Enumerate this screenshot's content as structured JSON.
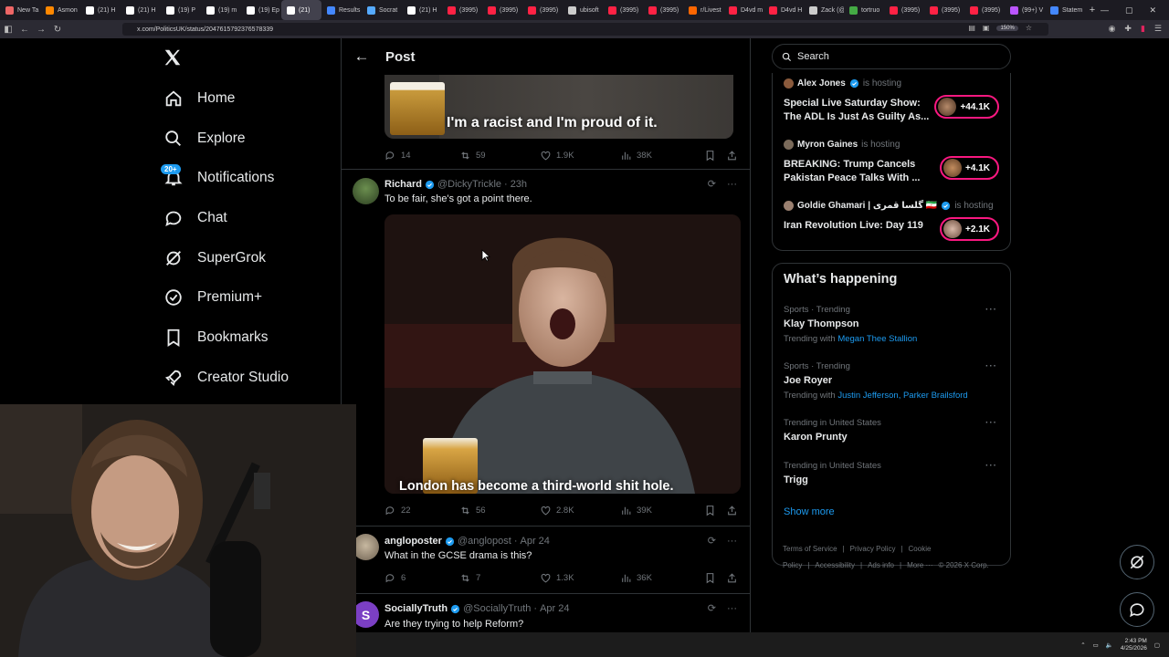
{
  "browser": {
    "tabs": [
      "New Ta",
      "Asmon",
      "(21) H",
      "(21) H",
      "(19) P",
      "(19) m",
      "(19) Ep",
      "(21)",
      "Results",
      "Socrat",
      "(21) H",
      "(3995)",
      "(3995)",
      "(3995)",
      "ubisoft",
      "(3995)",
      "(3995)",
      "r/Livest",
      "D4vd m",
      "D4vd H",
      "Zack (@",
      "tortruo",
      "(3995)",
      "(3995)",
      "(3995)",
      "(99+) V",
      "Statem"
    ],
    "url": "x.com/PoliticsUK/status/2047615792376578339",
    "zoom": "150%"
  },
  "leftnav": {
    "items": [
      {
        "label": "Home",
        "icon": "home-icon"
      },
      {
        "label": "Explore",
        "icon": "search-icon"
      },
      {
        "label": "Notifications",
        "icon": "bell-icon"
      },
      {
        "label": "Chat",
        "icon": "chat-icon"
      },
      {
        "label": "SuperGrok",
        "icon": "grok-icon"
      },
      {
        "label": "Premium+",
        "icon": "premium-icon"
      },
      {
        "label": "Bookmarks",
        "icon": "bookmark-icon"
      },
      {
        "label": "Creator Studio",
        "icon": "rocket-icon"
      }
    ],
    "notification_badge": "20+"
  },
  "header": {
    "title": "Post"
  },
  "tweets": [
    {
      "media_caption": "I'm a racist and I'm proud of it.",
      "replies": "14",
      "reposts": "59",
      "likes": "1.9K",
      "views": "38K"
    },
    {
      "name": "Richard",
      "handle": "@DickyTrickle",
      "time": "23h",
      "text": "To be fair, she's got a point there.",
      "media_caption": "London has become a third-world shit hole.",
      "replies": "22",
      "reposts": "56",
      "likes": "2.8K",
      "views": "39K"
    },
    {
      "name": "angloposter",
      "handle": "@anglopost",
      "time": "Apr 24",
      "text": "What in the GCSE drama is this?",
      "replies": "6",
      "reposts": "7",
      "likes": "1.3K",
      "views": "36K"
    },
    {
      "name": "SociallyTruth",
      "handle": "@SociallyTruth",
      "time": "Apr 24",
      "text": "Are they trying to help Reform?"
    }
  ],
  "search": {
    "placeholder": "Search"
  },
  "spaces": [
    {
      "host": "Alex Jones",
      "status": "is hosting",
      "title": "Special Live Saturday Show: The ADL Is Just As Guilty As...",
      "listeners": "+44.1K"
    },
    {
      "host": "Myron Gaines",
      "status": "is hosting",
      "title": "BREAKING: Trump Cancels Pakistan Peace Talks With ...",
      "listeners": "+4.1K"
    },
    {
      "host": "Goldie Ghamari | گلسا قمری 🇮🇷",
      "status": "is hosting",
      "title": "Iran Revolution Live: Day 119",
      "listeners": "+2.1K"
    }
  ],
  "whats_happening": {
    "title": "What’s happening",
    "trends": [
      {
        "meta": "Sports · Trending",
        "name": "Klay Thompson",
        "with_prefix": "Trending with",
        "with": "Megan Thee Stallion"
      },
      {
        "meta": "Sports · Trending",
        "name": "Joe Royer",
        "with_prefix": "Trending with",
        "with": "Justin Jefferson, Parker Brailsford"
      },
      {
        "meta": "Trending in United States",
        "name": "Karon Prunty",
        "with_prefix": "",
        "with": ""
      },
      {
        "meta": "Trending in United States",
        "name": "Trigg",
        "with_prefix": "",
        "with": ""
      }
    ],
    "show_more": "Show more"
  },
  "footer": {
    "links": [
      "Terms of Service",
      "|",
      "Privacy Policy",
      "|",
      "Cookie Policy",
      "|",
      "Accessibility",
      "|",
      "Ads info",
      "|",
      "More ···",
      "© 2026 X Corp."
    ]
  },
  "taskbar": {
    "time": "2:43 PM",
    "date": "4/25/2026"
  },
  "colors": {
    "accent": "#1d9bf0",
    "live": "#f91880",
    "background": "#000000",
    "muted": "#71767b"
  }
}
